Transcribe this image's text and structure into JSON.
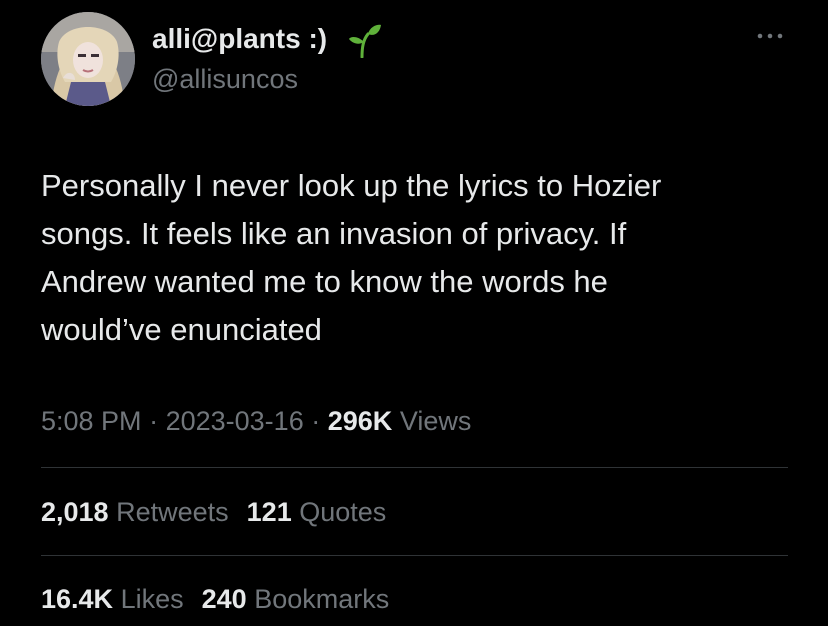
{
  "user": {
    "display_name": "alli@plants :)",
    "handle": "@allisuncos",
    "emoji_icon": "sprout-icon"
  },
  "tweet": {
    "lines": [
      "Personally I never look up the lyrics to Hozier",
      "songs. It feels like an invasion of privacy. If",
      "Andrew wanted me to know the words he",
      "would’ve enunciated"
    ]
  },
  "meta": {
    "time": "5:08 PM",
    "date": "2023-03-16",
    "separator": "·",
    "views_count": "296K",
    "views_label": "Views"
  },
  "stats": {
    "retweets_count": "2,018",
    "retweets_label": "Retweets",
    "quotes_count": "121",
    "quotes_label": "Quotes",
    "likes_count": "16.4K",
    "likes_label": "Likes",
    "bookmarks_count": "240",
    "bookmarks_label": "Bookmarks"
  },
  "colors": {
    "background": "#000000",
    "primary_text": "#e7e9ea",
    "secondary_text": "#71767b",
    "divider": "#2f3336",
    "sprout": "#5fb13a"
  }
}
